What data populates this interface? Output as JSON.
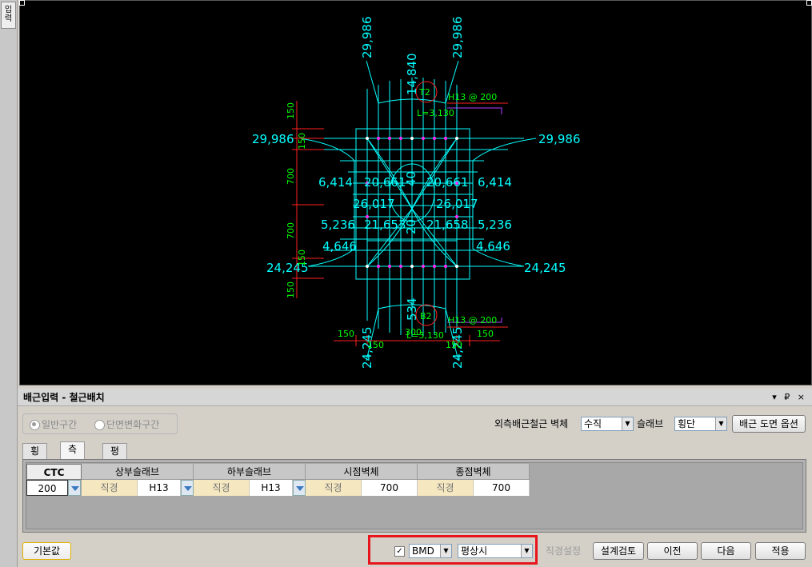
{
  "side_tab": {
    "label": "입력"
  },
  "drawing": {
    "top_dims": [
      "29,986",
      "14,840",
      "29,986"
    ],
    "top_tag": "T2",
    "top_rebar": "H13 @ 200",
    "top_length": "L=3,130",
    "bottom_tag": "B2",
    "bottom_rebar": "H13 @ 200",
    "bottom_length": "L=3,130",
    "bottom_dims": [
      "24,245",
      "534",
      "24,245"
    ],
    "left_spacing": [
      "150",
      "150",
      "700",
      "700",
      "150",
      "150"
    ],
    "bottom_spacing": [
      "150",
      "150",
      "300",
      "150",
      "150"
    ],
    "left_values": [
      "29,986",
      "6,414",
      "20,661",
      "26,017",
      "5,236",
      "21,653",
      "4,646",
      "24,245"
    ],
    "right_values": [
      "29,986",
      "6,414",
      "20,661",
      "26,017",
      "5,236",
      "21,658",
      "4,646",
      "24,245"
    ],
    "center_values": [
      "40",
      "20"
    ]
  },
  "panel": {
    "title": "배근입력 - 철근배치",
    "title_controls": "▾ ₽ ×"
  },
  "radios": {
    "general": "일반구간",
    "section_change": "단면변화구간"
  },
  "options": {
    "outer_wall_label": "외측배근철근 벽체",
    "outer_wall_value": "수직",
    "slab_label": "슬래브",
    "slab_value": "횡단",
    "drawing_options_button": "배근 도면 옵션"
  },
  "tabs": [
    "횡단",
    "측면",
    "평면"
  ],
  "table": {
    "headers": [
      "CTC",
      "상부슬래브",
      "하부슬래브",
      "시점벽체",
      "종점벽체"
    ],
    "row": {
      "ctc": "200",
      "top_dia_label": "직경",
      "top_dia_value": "H13",
      "bot_dia_label": "직경",
      "bot_dia_value": "H13",
      "start_dia_label": "직경",
      "start_value": "700",
      "end_dia_label": "직경",
      "end_value": "700"
    }
  },
  "footer": {
    "default_button": "기본값",
    "bmd_checkbox": "✓",
    "bmd_value": "BMD",
    "condition_value": "평상시",
    "dia_setting_button": "직경설정",
    "design_check_button": "설계검토",
    "prev_button": "이전",
    "next_button": "다음",
    "apply_button": "적용"
  },
  "colors": {
    "cad_lines": "#00ffff",
    "cad_dims": "#ff2020",
    "cad_text_green": "#00ff00",
    "cad_bg": "#000000",
    "highlight_box": "#e8141c"
  }
}
